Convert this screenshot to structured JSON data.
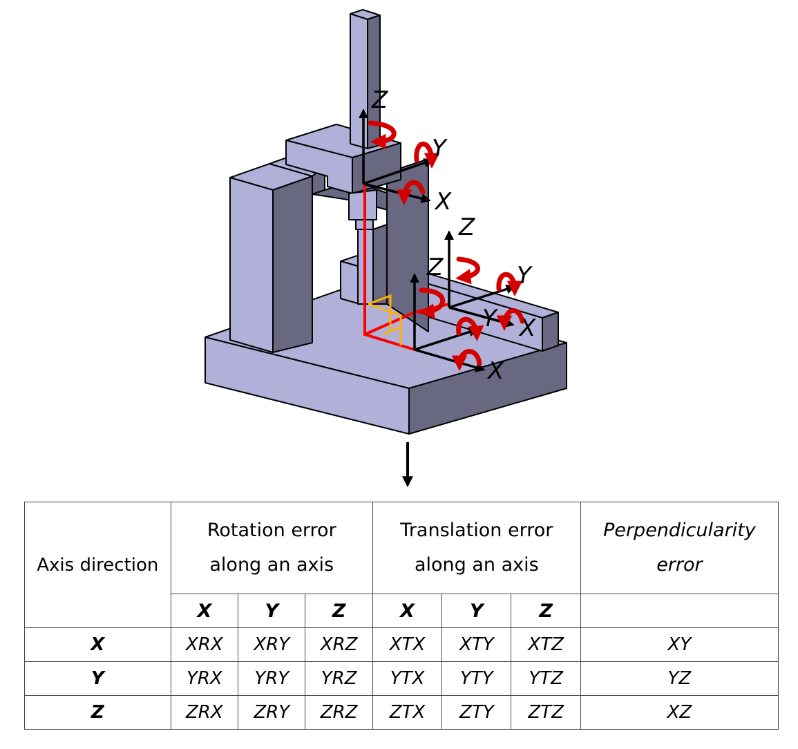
{
  "figure": {
    "description": "Isometric view of a three-axis machine (bridge/gantry with vertical ram) showing coordinate frames and rotation arrows for each linear axis",
    "colors": {
      "face_light": "#b0b0d8",
      "face_dark": "#686880",
      "edge": "#000000",
      "kinematic_chain": "#ff0000",
      "rotation_arrow": "#d40000",
      "workpiece_frame": "#ffb000",
      "axis_arrow": "#000000"
    },
    "frames": [
      {
        "name": "ram-frame",
        "axes": [
          "Z",
          "Y",
          "X"
        ]
      },
      {
        "name": "table-frame-upper",
        "axes": [
          "Z",
          "Y",
          "X"
        ]
      },
      {
        "name": "table-frame-lower",
        "axes": [
          "Z",
          "Y",
          "X"
        ]
      }
    ],
    "axis_labels": {
      "top_z": "Z",
      "top_y": "Y",
      "top_x": "X",
      "mid_z": "Z",
      "mid_y": "Y",
      "mid_x": "X",
      "low_z": "Z",
      "low_y": "Y",
      "low_x": "X"
    }
  },
  "table": {
    "header": {
      "axis_direction": "Axis direction",
      "rotation_group": [
        "Rotation error",
        "along an axis"
      ],
      "translation_group": [
        "Translation error",
        "along an axis"
      ],
      "perpendicularity_group": [
        "Perpendicularity",
        "error"
      ],
      "sub_axes_rotation": [
        "X",
        "Y",
        "Z"
      ],
      "sub_axes_translation": [
        "X",
        "Y",
        "Z"
      ],
      "perpendicularity_sub": ""
    },
    "rows": [
      {
        "axis": "X",
        "rotation": [
          "XRX",
          "XRY",
          "XRZ"
        ],
        "translation": [
          "XTX",
          "XTY",
          "XTZ"
        ],
        "perpendicularity": "XY"
      },
      {
        "axis": "Y",
        "rotation": [
          "YRX",
          "YRY",
          "YRZ"
        ],
        "translation": [
          "YTX",
          "YTY",
          "YTZ"
        ],
        "perpendicularity": "YZ"
      },
      {
        "axis": "Z",
        "rotation": [
          "ZRX",
          "ZRY",
          "ZRZ"
        ],
        "translation": [
          "ZTX",
          "ZTY",
          "ZTZ"
        ],
        "perpendicularity": "XZ"
      }
    ]
  }
}
